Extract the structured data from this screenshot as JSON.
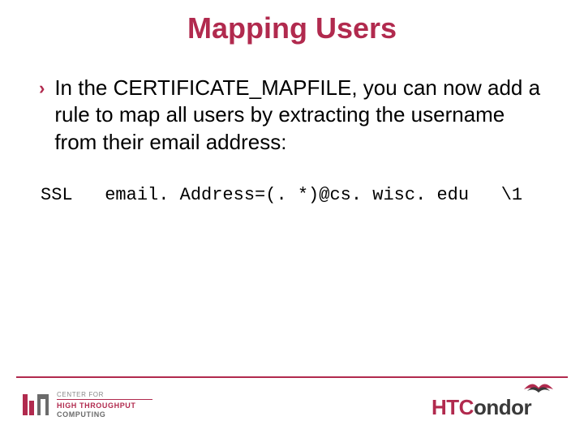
{
  "title": "Mapping Users",
  "bullet": {
    "text": "In the CERTIFICATE_MAPFILE, you can now add a rule to map all users by extracting the username from their email address:"
  },
  "code": {
    "line": "SSL   email. Address=(. *)@cs. wisc. edu   \\1"
  },
  "footer": {
    "chtc": {
      "line1": "CENTER FOR",
      "line2": "HIGH THROUGHPUT",
      "line3": "COMPUTING"
    },
    "condor": {
      "ht": "HTC",
      "rest": "ondor"
    }
  }
}
